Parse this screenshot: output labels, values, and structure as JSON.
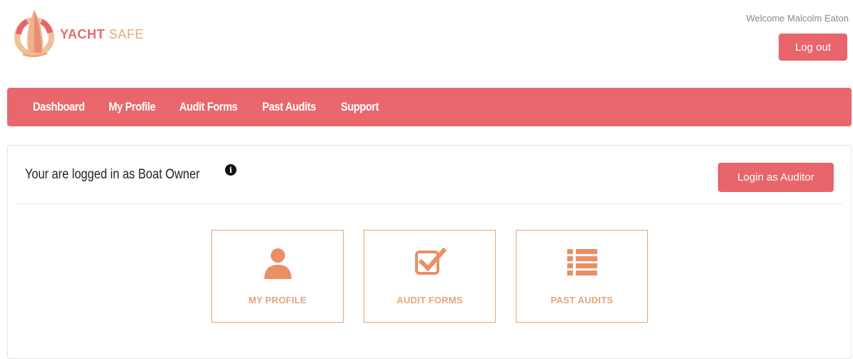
{
  "brand": {
    "name_bold": "YACHT",
    "name_light": "SAFE",
    "color_primary": "#e8656b",
    "color_accent": "#e6a67a"
  },
  "header": {
    "welcome": "Welcome Malcolm Eaton",
    "logout_label": "Log out"
  },
  "nav": {
    "items": [
      {
        "label": "Dashboard"
      },
      {
        "label": "My Profile"
      },
      {
        "label": "Audit Forms"
      },
      {
        "label": "Past Audits"
      },
      {
        "label": "Support"
      }
    ]
  },
  "panel": {
    "role_text": "Your are logged in as Boat Owner",
    "info_icon": "info-icon",
    "switch_label": "Login as Auditor"
  },
  "tiles": [
    {
      "label": "MY PROFILE",
      "icon": "user-icon"
    },
    {
      "label": "AUDIT FORMS",
      "icon": "checkbox-icon"
    },
    {
      "label": "PAST AUDITS",
      "icon": "list-icon"
    }
  ]
}
